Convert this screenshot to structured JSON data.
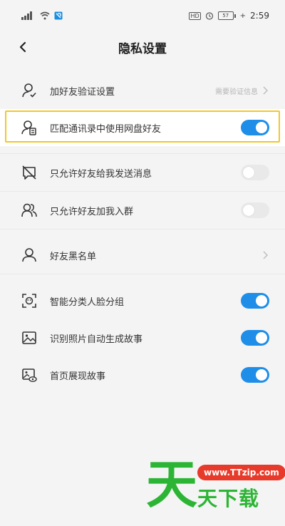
{
  "status_bar": {
    "time": "2:59",
    "hd": "HD",
    "battery": "57"
  },
  "header": {
    "title": "隐私设置"
  },
  "settings": [
    {
      "label": "加好友验证设置",
      "value": "需要验证信息",
      "type": "link",
      "icon": "user-verify-icon"
    },
    {
      "label": "匹配通讯录中使用网盘好友",
      "type": "toggle",
      "on": true,
      "icon": "contacts-match-icon"
    },
    {
      "label": "只允许好友给我发送消息",
      "type": "toggle",
      "on": false,
      "icon": "message-block-icon"
    },
    {
      "label": "只允许好友加我入群",
      "type": "toggle",
      "on": false,
      "icon": "group-users-icon"
    },
    {
      "label": "好友黑名单",
      "type": "link",
      "icon": "user-icon"
    },
    {
      "label": "智能分类人脸分组",
      "type": "toggle",
      "on": true,
      "icon": "face-scan-icon"
    },
    {
      "label": "识别照片自动生成故事",
      "type": "toggle",
      "on": true,
      "icon": "photo-icon"
    },
    {
      "label": "首页展现故事",
      "type": "toggle",
      "on": true,
      "icon": "photo-view-icon"
    }
  ],
  "watermark": {
    "big": "天",
    "site": "www.TTzip.com",
    "text": "天下载"
  },
  "colors": {
    "accent": "#1e8ee8",
    "highlight": "#f2c828",
    "watermark_green": "#2cb534",
    "watermark_red": "#e83a2a"
  }
}
